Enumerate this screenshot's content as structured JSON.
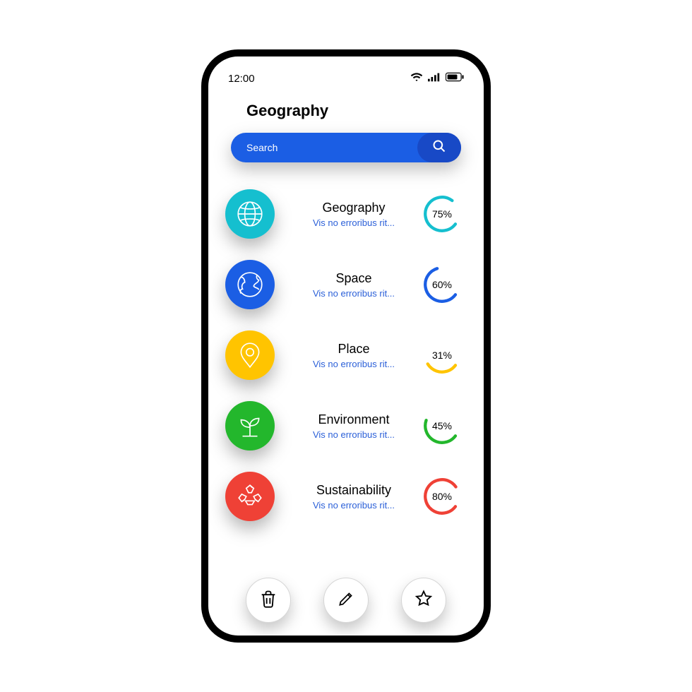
{
  "status": {
    "time": "12:00"
  },
  "page": {
    "title": "Geography"
  },
  "search": {
    "placeholder": "Search"
  },
  "colors": {
    "blue_primary": "#1b5ee4",
    "blue_dark": "#1849c6"
  },
  "items": [
    {
      "title": "Geography",
      "subtitle": "Vis no erroribus rit...",
      "percent": 75,
      "percent_label": "75%",
      "color": "#15bfcf",
      "icon": "globe"
    },
    {
      "title": "Space",
      "subtitle": "Vis no erroribus rit...",
      "percent": 60,
      "percent_label": "60%",
      "color": "#1b5ee4",
      "icon": "planet"
    },
    {
      "title": "Place",
      "subtitle": "Vis no erroribus rit...",
      "percent": 31,
      "percent_label": "31%",
      "color": "#ffc400",
      "icon": "pin"
    },
    {
      "title": "Environment",
      "subtitle": "Vis no erroribus rit...",
      "percent": 45,
      "percent_label": "45%",
      "color": "#23b72c",
      "icon": "sprout"
    },
    {
      "title": "Sustainability",
      "subtitle": "Vis no erroribus rit...",
      "percent": 80,
      "percent_label": "80%",
      "color": "#ef4136",
      "icon": "recycle"
    }
  ],
  "actions": [
    {
      "name": "trash"
    },
    {
      "name": "edit"
    },
    {
      "name": "star"
    }
  ]
}
